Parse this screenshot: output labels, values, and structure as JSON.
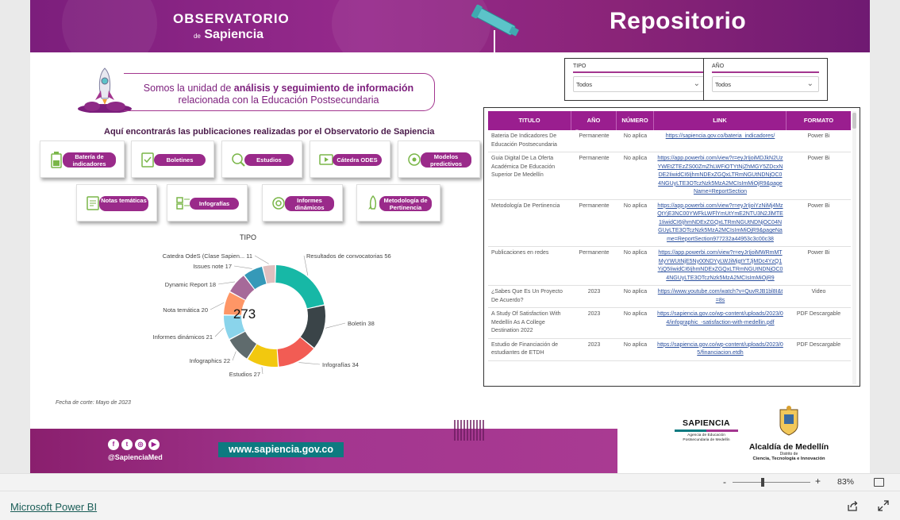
{
  "header": {
    "brand_line1": "OBSERVATORIO",
    "brand_line2": "Sapiencia",
    "brand_connector": "de",
    "title": "Repositorio"
  },
  "intro": {
    "text_prefix": "Somos la unidad de ",
    "text_bold": "análisis y seguimiento de información",
    "text_suffix": "relacionada con la Educación Postsecundaria"
  },
  "publications_heading": "Aquí encontrarás las publicaciones realizadas por el Observatorio de Sapiencia",
  "categories": [
    {
      "label": "Batería de indicadores",
      "icon": "battery-icon"
    },
    {
      "label": "Boletines",
      "icon": "checklist-icon"
    },
    {
      "label": "Estudios",
      "icon": "magnifier-icon"
    },
    {
      "label": "Cátedra ODES",
      "icon": "video-play-icon"
    },
    {
      "label": "Modelos predictivos",
      "icon": "brain-gear-icon"
    },
    {
      "label": "Notas temáticas",
      "icon": "notes-icon"
    },
    {
      "label": "Infografías",
      "icon": "infographic-icon"
    },
    {
      "label": "Informes dinámicos",
      "icon": "target-icon"
    },
    {
      "label": "Metodología de Pertinencia",
      "icon": "rocket-icon"
    }
  ],
  "chart_data": {
    "type": "pie",
    "title": "TIPO",
    "total_label": "273",
    "categories": [
      "Resultados de convocatorias",
      "Boletín",
      "Infografías",
      "Estudios",
      "Infographics",
      "Informes dinámicos",
      "Nota temática",
      "Dynamic Report",
      "Issues note",
      "Catedra OdeS (Clase Sapien..."
    ],
    "values": [
      56,
      38,
      34,
      27,
      22,
      21,
      20,
      18,
      17,
      11
    ],
    "label_texts": [
      "Resultados de convocatorias 56",
      "Boletín 38",
      "Infografías 34",
      "Estudios 27",
      "Infographics 22",
      "Informes dinámicos 21",
      "Nota temática 20",
      "Dynamic Report 18",
      "Issues note 17",
      "Catedra OdeS (Clase Sapien... 11"
    ],
    "colors": [
      "#17b8a6",
      "#3a4448",
      "#f25c54",
      "#f2c80f",
      "#5f6b6d",
      "#8ad4eb",
      "#fe9666",
      "#a66999",
      "#3599b8",
      "#dfbfbf"
    ]
  },
  "cutoff_note": "Fecha de corte: Mayo de 2023",
  "filters": [
    {
      "label": "TIPO",
      "value": "Todos"
    },
    {
      "label": "AÑO",
      "value": "Todos"
    }
  ],
  "table": {
    "columns": [
      "TITULO",
      "AÑO",
      "NÚMERO",
      "LINK",
      "FORMATO"
    ],
    "rows": [
      {
        "titulo": "Bateria De Indicadores De Educación Postsecundaria",
        "anio": "Permanente",
        "numero": "No aplica",
        "link": "https://sapiencia.gov.co/bateria_indicadores/",
        "formato": "Power Bi"
      },
      {
        "titulo": "Guia Digital De La Oferta Académica De Educación Superior De Medellín",
        "anio": "Permanente",
        "numero": "No aplica",
        "link": "https://app.powerbi.com/view?r=eyJrIjoiMDJkN2UzYWEtZTEzZS00ZmZhLWFiOTYtNjZhMGY5ZDcxNDE2IiwidCI6IjhmNDExZGQxLTRmNGUtNDNjOC04NGUyLTE3OTczNzk5MzA2MCIsImMiOjR9&pageName=ReportSection",
        "formato": "Power Bi"
      },
      {
        "titulo": "Metodología De Pertinencia",
        "anio": "Permanente",
        "numero": "No aplica",
        "link": "https://app.powerbi.com/view?r=eyJrIjoiYzNiMj4MzQtYjE3NC00YWFkLWFlYmUtYmE2NTU3N2JlMTE1IiwidCI6IjhmNDExZGQxLTRmNGUtNDNjOC04NGUyLTE3OTczNzk5MzA2MCIsImMiOjR9&pageName=ReportSection977232a44953c3c00c38",
        "formato": "Power Bi"
      },
      {
        "titulo": "Publicaciones en redes",
        "anio": "Permanente",
        "numero": "No aplica",
        "link": "https://app.powerbi.com/view?r=eyJrIjoiMWRmMTMyYWUtNjE5Ny00NDYyLWJiMjgtYTJjMDc4YzQ1YjQ5IiwidCI6IjhmNDExZGQxLTRmNGUtNDNjOC04NGUyLTE3OTczNzk5MzA2MCIsImMiOjR9",
        "formato": "Power Bi"
      },
      {
        "titulo": "¿Sabes Que Es Un Proyecto De Acuerdo?",
        "anio": "2023",
        "numero": "No aplica",
        "link": "https://www.youtube.com/watch?v=QuvRJB1bl8I&t=8s",
        "formato": "Video"
      },
      {
        "titulo": "A Study Of Satisfaction With Medellín As A College Destination 2022",
        "anio": "2023",
        "numero": "No aplica",
        "link": "https://sapiencia.gov.co/wp-content/uploads/2023/04/infographic_-satisfaction-with-medellin.pdf",
        "formato": "PDF Descargable"
      },
      {
        "titulo": "Estudio de Financiación de estudiantes de ETDH",
        "anio": "2023",
        "numero": "No aplica",
        "link": "https://sapiencia.gov.co/wp-content/uploads/2023/05/financiacion.etdh",
        "formato": "PDF Descargable"
      }
    ]
  },
  "footer": {
    "handle": "@SapienciaMed",
    "site": "www.sapiencia.gov.co",
    "sapiencia_name": "SAPIENCIA",
    "sapiencia_sub1": "Agencia de Educación",
    "sapiencia_sub2": "Postsecundaria de Medellín",
    "medellin_name": "Alcaldía de Medellín",
    "medellin_sub1": "Distrito de",
    "medellin_sub2": "Ciencia, Tecnología e Innovación"
  },
  "zoom": {
    "value": "83%",
    "level_percent": 83
  },
  "bottom": {
    "link": "Microsoft Power BI"
  }
}
